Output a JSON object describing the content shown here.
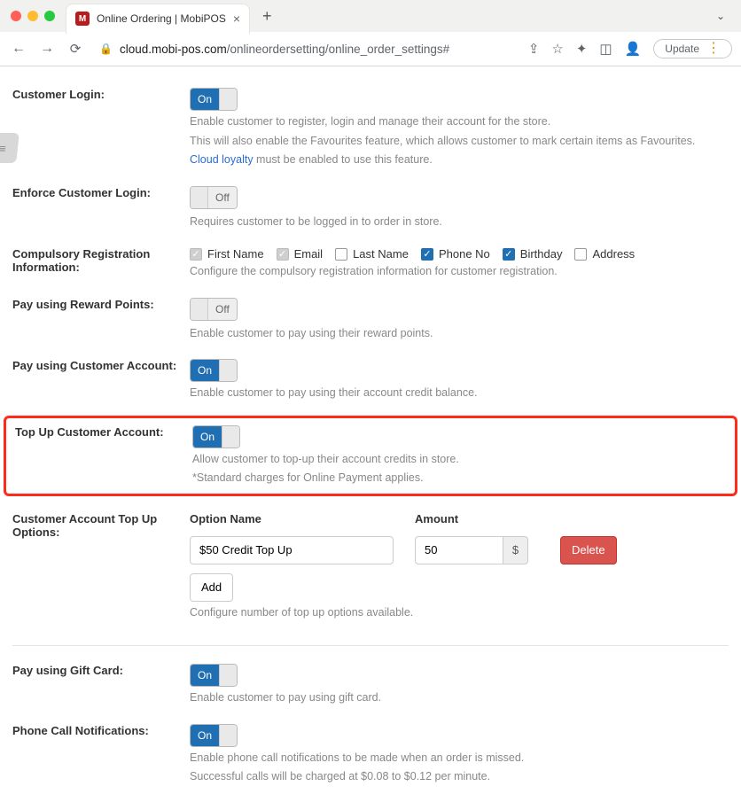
{
  "chrome": {
    "tab_title": "Online Ordering | MobiPOS",
    "favicon_letter": "M",
    "url_host": "cloud.mobi-pos.com",
    "url_path": "/onlineordersetting/online_order_settings#",
    "update_label": "Update"
  },
  "toggles": {
    "on": "On",
    "off": "Off"
  },
  "settings": {
    "customer_login": {
      "label": "Customer Login:",
      "state": "on",
      "help1": "Enable customer to register, login and manage their account for the store.",
      "help2": "This will also enable the Favourites feature, which allows customer to mark certain items as Favourites.",
      "link_text": "Cloud loyalty",
      "help3_rest": " must be enabled to use this feature."
    },
    "enforce_login": {
      "label": "Enforce Customer Login:",
      "state": "off",
      "help": "Requires customer to be logged in to order in store."
    },
    "comp_reg": {
      "label": "Compulsory Registration Information:",
      "help": "Configure the compulsory registration information for customer registration.",
      "items": [
        {
          "label": "First Name",
          "state": "locked"
        },
        {
          "label": "Email",
          "state": "locked"
        },
        {
          "label": "Last Name",
          "state": "unchecked"
        },
        {
          "label": "Phone No",
          "state": "checked"
        },
        {
          "label": "Birthday",
          "state": "checked"
        },
        {
          "label": "Address",
          "state": "unchecked"
        }
      ]
    },
    "reward_points": {
      "label": "Pay using Reward Points:",
      "state": "off",
      "help": "Enable customer to pay using their reward points."
    },
    "cust_account": {
      "label": "Pay using Customer Account:",
      "state": "on",
      "help": "Enable customer to pay using their account credit balance."
    },
    "topup": {
      "label": "Top Up Customer Account:",
      "state": "on",
      "help1": "Allow customer to top-up their account credits in store.",
      "help2": "*Standard charges for Online Payment applies."
    },
    "topup_options": {
      "label": "Customer Account Top Up Options:",
      "col_name": "Option Name",
      "col_amount": "Amount",
      "name_value": "$50 Credit Top Up",
      "amount_value": "50",
      "currency": "$",
      "delete_label": "Delete",
      "add_label": "Add",
      "help": "Configure number of top up options available."
    },
    "gift_card": {
      "label": "Pay using Gift Card:",
      "state": "on",
      "help": "Enable customer to pay using gift card."
    },
    "phone_notif": {
      "label": "Phone Call Notifications:",
      "state": "on",
      "help1": "Enable phone call notifications to be made when an order is missed.",
      "help2": "Successful calls will be charged at $0.08 to $0.12 per minute."
    }
  }
}
